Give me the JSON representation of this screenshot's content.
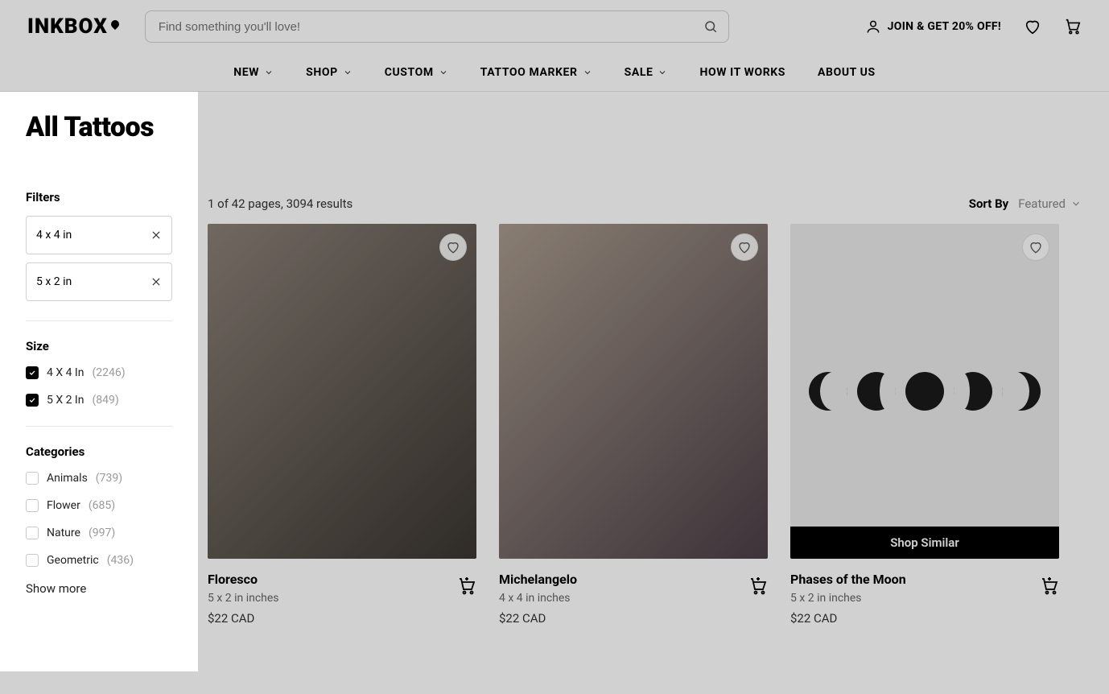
{
  "header": {
    "logo": "INKBOX",
    "search_placeholder": "Find something you'll love!",
    "account_text": "JOIN & GET 20% OFF!"
  },
  "nav": {
    "items": [
      {
        "label": "NEW",
        "dropdown": true
      },
      {
        "label": "SHOP",
        "dropdown": true
      },
      {
        "label": "CUSTOM",
        "dropdown": true
      },
      {
        "label": "TATTOO MARKER",
        "dropdown": true
      },
      {
        "label": "SALE",
        "dropdown": true
      },
      {
        "label": "HOW IT WORKS",
        "dropdown": false
      },
      {
        "label": "ABOUT US",
        "dropdown": false
      }
    ]
  },
  "sidebar": {
    "title": "All Tattoos",
    "filters_label": "Filters",
    "active_filters": [
      {
        "label": "4 x 4 in"
      },
      {
        "label": "5 x 2 in"
      }
    ],
    "size_title": "Size",
    "sizes": [
      {
        "label": "4 X 4 In",
        "count": "(2246)",
        "checked": true
      },
      {
        "label": "5 X 2 In",
        "count": "(849)",
        "checked": true
      }
    ],
    "categories_title": "Categories",
    "categories": [
      {
        "label": "Animals",
        "count": "(739)",
        "checked": false
      },
      {
        "label": "Flower",
        "count": "(685)",
        "checked": false
      },
      {
        "label": "Nature",
        "count": "(997)",
        "checked": false
      },
      {
        "label": "Geometric",
        "count": "(436)",
        "checked": false
      }
    ],
    "show_more": "Show more"
  },
  "main": {
    "results_text": "1 of 42 pages, 3094 results",
    "sort_label": "Sort By",
    "sort_value": "Featured",
    "shop_similar": "Shop Similar",
    "products": [
      {
        "title": "Floresco",
        "dimensions": "5 x 2 in inches",
        "price": "$22 CAD"
      },
      {
        "title": "Michelangelo",
        "dimensions": "4 x 4 in inches",
        "price": "$22 CAD"
      },
      {
        "title": "Phases of the Moon",
        "dimensions": "5 x 2 in inches",
        "price": "$22 CAD"
      }
    ]
  }
}
